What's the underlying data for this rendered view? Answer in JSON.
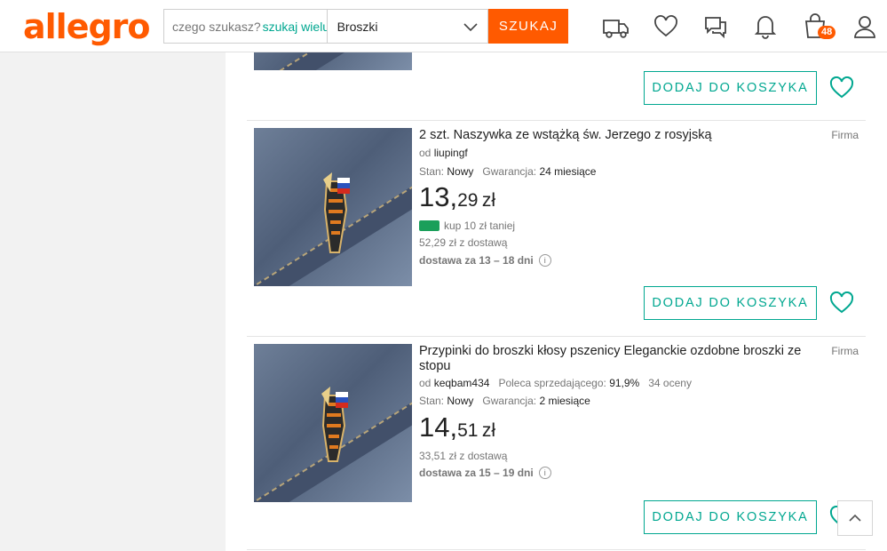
{
  "header": {
    "logo": "allegro",
    "search_placeholder": "czego szukasz?",
    "search_hint_accent": "szukaj wielu",
    "category": "Broszki",
    "search_button": "SZUKAJ",
    "cart_count": "48",
    "icons": [
      "delivery-truck-icon",
      "heart-icon",
      "chat-icon",
      "bell-icon",
      "cart-icon",
      "user-icon"
    ]
  },
  "listings": [
    {
      "add_to_cart": "DODAJ DO KOSZYKA"
    },
    {
      "title": "2 szt. Naszywka ze wstążką św. Jerzego z rosyjską",
      "seller_type": "Firma",
      "seller_prefix": "od",
      "seller": "liupingf",
      "condition_label": "Stan:",
      "condition": "Nowy",
      "warranty_label": "Gwarancja:",
      "warranty": "24 miesiące",
      "price_int": "13,",
      "price_frac": "29",
      "currency": "zł",
      "deal": "kup 10 zł taniej",
      "with_delivery": "52,29 zł z dostawą",
      "delivery_time": "dostawa za 13 – 18 dni",
      "add_to_cart": "DODAJ DO KOSZYKA"
    },
    {
      "title": "Przypinki do broszki kłosy pszenicy Eleganckie ozdobne broszki ze stopu",
      "seller_type": "Firma",
      "seller_prefix": "od",
      "seller": "keqbam434",
      "recommend_label": "Poleca sprzedającego:",
      "recommend": "91,9%",
      "ratings": "34 oceny",
      "condition_label": "Stan:",
      "condition": "Nowy",
      "warranty_label": "Gwarancja:",
      "warranty": "2 miesiące",
      "price_int": "14,",
      "price_frac": "51",
      "currency": "zł",
      "with_delivery": "33,51 zł z dostawą",
      "delivery_time": "dostawa za 15 – 19 dni",
      "add_to_cart": "DODAJ DO KOSZYKA"
    }
  ],
  "colors": {
    "brand": "#ff5a00",
    "accent": "#00a790"
  }
}
